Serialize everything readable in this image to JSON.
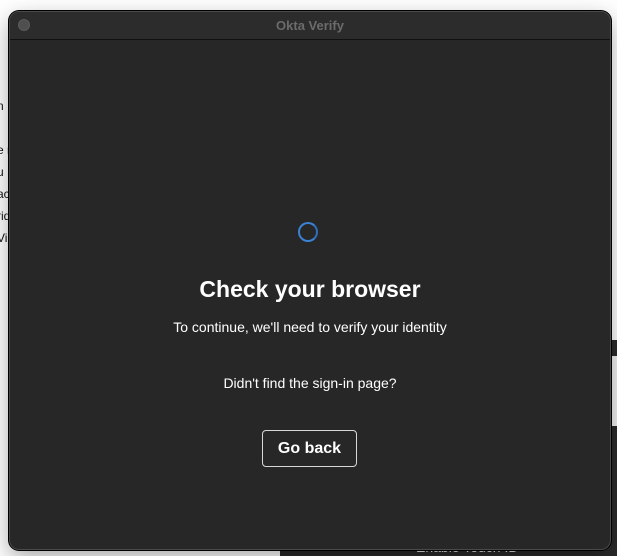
{
  "background": {
    "left_fragments": [
      "n",
      "",
      "e r",
      "u",
      "ac",
      "rid",
      "Vi"
    ],
    "bottom_label": "Enable Touch ID"
  },
  "window": {
    "title": "Okta Verify"
  },
  "dialog": {
    "heading": "Check your browser",
    "subtext": "To continue, we'll need to verify your identity",
    "help_text": "Didn't find the sign-in page?",
    "go_back_label": "Go back"
  },
  "colors": {
    "window_background": "#272727",
    "titlebar_background": "#2c2c2c",
    "spinner_accent": "#3b82d6",
    "text_primary": "#ffffff",
    "title_text": "#6b6b6b"
  },
  "icons": {
    "spinner": "loading-spinner-icon",
    "window_control": "close-traffic-light"
  }
}
